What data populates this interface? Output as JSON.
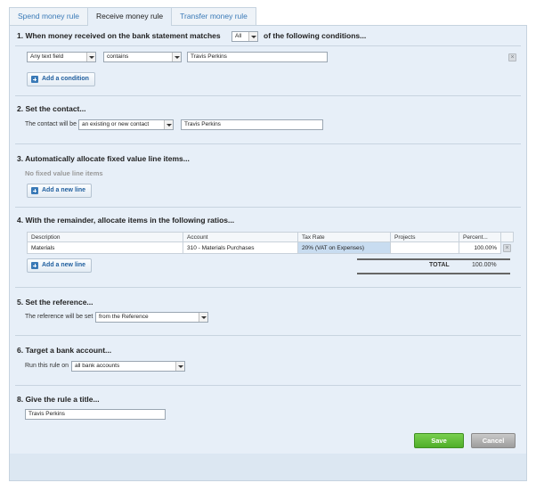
{
  "tabs": [
    "Spend money rule",
    "Receive money rule",
    "Transfer money rule"
  ],
  "section1": {
    "heading_pre": "1. When money received on the bank statement matches",
    "match_value": "All",
    "heading_post": "of the following conditions...",
    "field_select": "Any text field",
    "operator_select": "contains",
    "value_input": "Travis Perkins",
    "add_button": "Add a condition"
  },
  "section2": {
    "heading": "2. Set the contact...",
    "label": "The contact will be",
    "contact_type": "an existing or new contact",
    "contact_input": "Travis Perkins"
  },
  "section3": {
    "heading": "3. Automatically allocate fixed value line items...",
    "empty_text": "No fixed value line items",
    "add_button": "Add a new line"
  },
  "section4": {
    "heading": "4. With the remainder, allocate items in the following ratios...",
    "columns": [
      "Description",
      "Account",
      "Tax Rate",
      "Projects",
      "Percent..."
    ],
    "row": {
      "description": "Materials",
      "account": "310 - Materials Purchases",
      "tax_rate": "20% (VAT on Expenses)",
      "projects": "",
      "percent": "100.00%"
    },
    "add_button": "Add a new line",
    "total_label": "TOTAL",
    "total_value": "100.00%"
  },
  "section5": {
    "heading": "5. Set the reference...",
    "label": "The reference will be set",
    "reference_select": "from the Reference"
  },
  "section6": {
    "heading": "6. Target a bank account...",
    "label": "Run this rule on",
    "account_select": "all bank accounts"
  },
  "section8": {
    "heading": "8. Give the rule a title...",
    "title_input": "Travis Perkins"
  },
  "footer": {
    "save": "Save",
    "cancel": "Cancel"
  },
  "colors": {
    "accent": "#3a7ab7",
    "panel": "#e7eff8",
    "save": "#5cb933",
    "cancel": "#a8a8a8"
  }
}
